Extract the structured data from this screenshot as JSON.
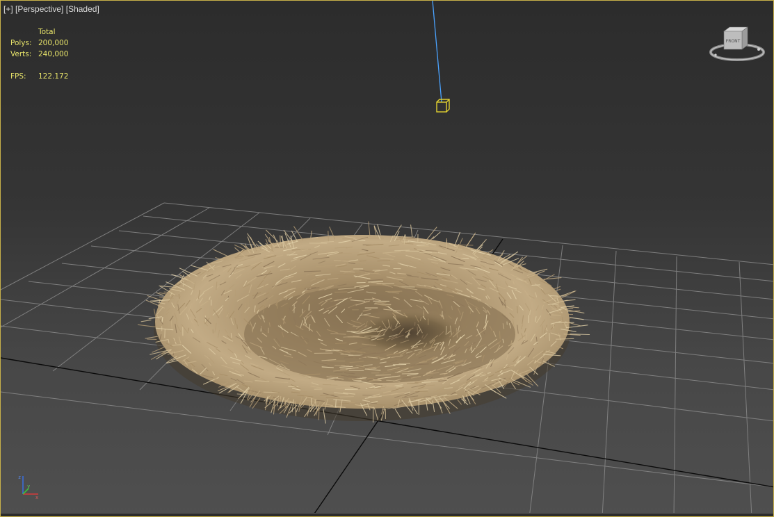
{
  "viewport": {
    "menu_plus": "[+]",
    "view_name": "[Perspective]",
    "shading_mode": "[Shaded]"
  },
  "stats": {
    "header": "Total",
    "polys_label": "Polys:",
    "polys_value": "200,000",
    "verts_label": "Verts:",
    "verts_value": "240,000",
    "fps_label": "FPS:",
    "fps_value": "122.172"
  },
  "viewcube": {
    "face_label": "FRONT",
    "icon": "viewcube-icon"
  },
  "colors": {
    "border": "#c9b24a",
    "stats_text": "#e8e46a",
    "grid": "#8a8a8a",
    "grid_axis": "#0a0a0a",
    "nest": "#b8a07a",
    "light_line": "#4aa3ff",
    "light_box": "#e0d030"
  },
  "scene_objects": {
    "grid": "ground-grid",
    "nest": "straw-nest",
    "light": "target-light"
  }
}
